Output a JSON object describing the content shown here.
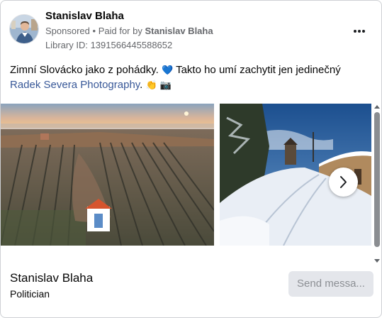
{
  "ad": {
    "page_name": "Stanislav Blaha",
    "sponsored_label": "Sponsored",
    "separator": "•",
    "paid_for_prefix": "Paid for by",
    "paid_for_name": "Stanislav Blaha",
    "library_id": "Library ID: 1391566445588652",
    "more_icon": "more-horizontal-icon"
  },
  "post": {
    "text_before": "Zimní Slovácko jako z pohádky. ",
    "heart_emoji": "💙",
    "text_middle": " Takto ho umí zachytit jen jedinečný ",
    "link_text": "Radek Severa Photography",
    "text_after": ". ",
    "emoji_hands": "👏",
    "emoji_camera": "📷"
  },
  "carousel": {
    "slides": [
      {
        "scene": "aerial-vineyard-sunset-chapel"
      },
      {
        "scene": "snowy-lane-windmill-wine-cellars"
      }
    ],
    "next_icon": "chevron-right-icon"
  },
  "footer": {
    "name": "Stanislav Blaha",
    "role": "Politician",
    "send_button": "Send messa..."
  },
  "colors": {
    "link": "#385898",
    "secondary_text": "#65676b",
    "button_bg": "#e4e6eb",
    "button_text": "#8c8f94"
  }
}
